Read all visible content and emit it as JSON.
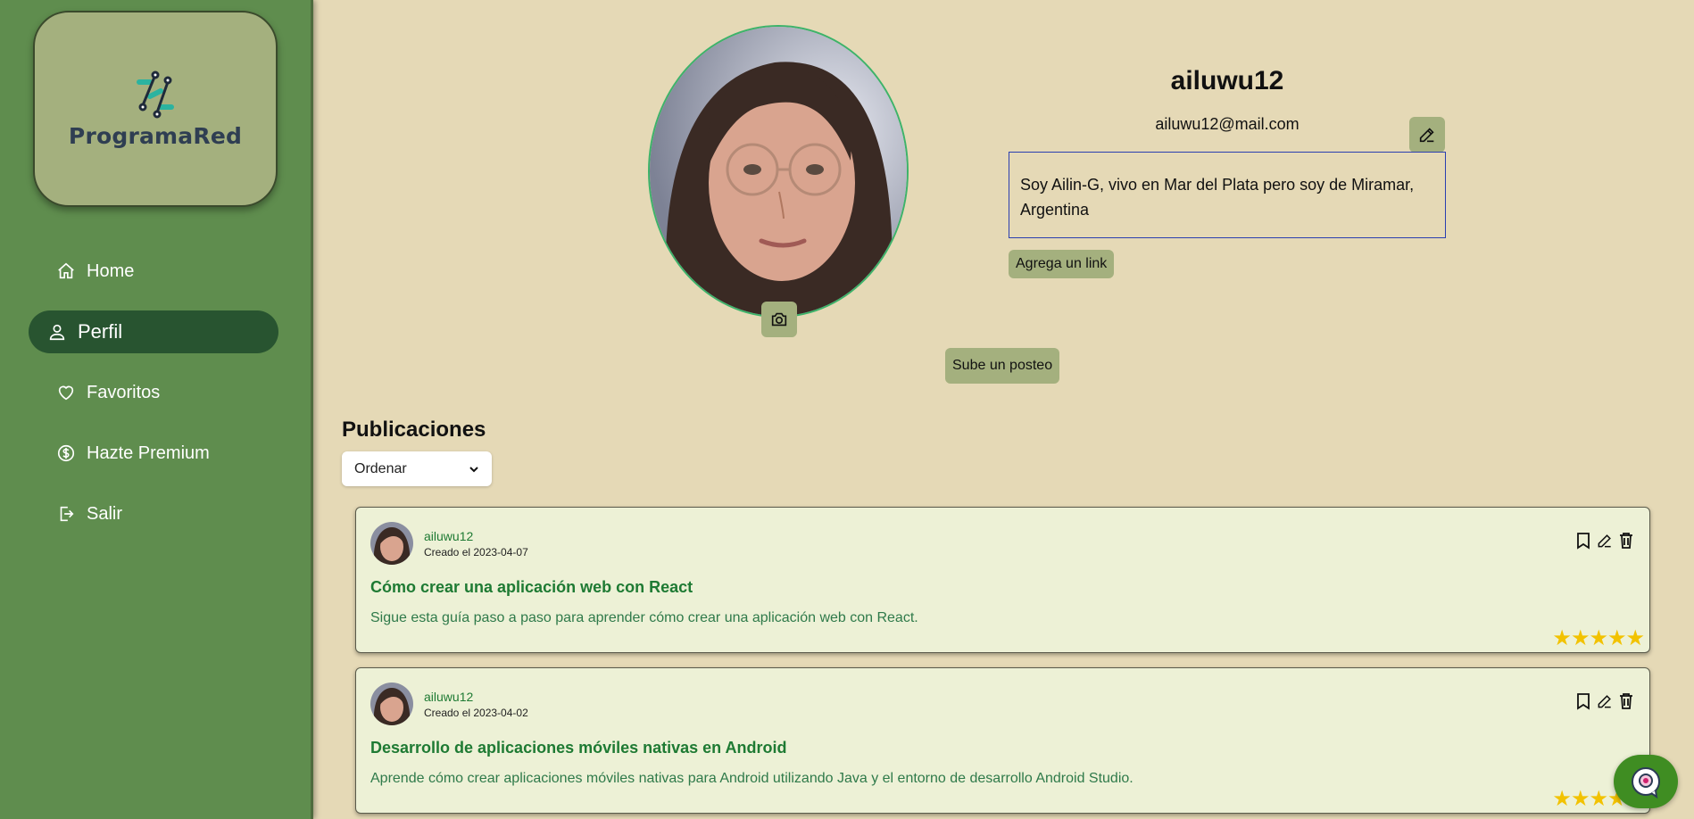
{
  "brand": {
    "name": "ProgramaRed",
    "logo_icon": "programared-logo"
  },
  "sidebar": {
    "items": [
      {
        "label": "Home",
        "icon": "home-icon"
      },
      {
        "label": "Perfil",
        "icon": "user-icon",
        "active": true
      },
      {
        "label": "Favoritos",
        "icon": "heart-icon"
      },
      {
        "label": "Hazte Premium",
        "icon": "dollar-circle-icon"
      },
      {
        "label": "Salir",
        "icon": "logout-icon"
      }
    ]
  },
  "profile": {
    "username": "ailuwu12",
    "email": "ailuwu12@mail.com",
    "bio": "Soy Ailin-G, vivo en Mar del Plata pero soy de Miramar, Argentina",
    "add_link_label": "Agrega un link",
    "upload_post_label": "Sube un posteo"
  },
  "publications": {
    "title": "Publicaciones",
    "sort": {
      "selected": "Ordenar"
    },
    "posts": [
      {
        "user": "ailuwu12",
        "date": "Creado el 2023-04-07",
        "title": "Cómo crear una aplicación web con React",
        "description": "Sigue esta guía paso a paso para aprender cómo crear una aplicación web con React.",
        "rating": 5
      },
      {
        "user": "ailuwu12",
        "date": "Creado el 2023-04-02",
        "title": "Desarrollo de aplicaciones móviles nativas en Android",
        "description": "Aprende cómo crear aplicaciones móviles nativas para Android utilizando Java y el entorno de desarrollo Android Studio.",
        "rating": 5
      }
    ]
  },
  "colors": {
    "background": "#e5d9b6",
    "sidebar": "#5f8d4e",
    "active_nav": "#285430",
    "button": "#a4b07e",
    "card": "#edf1d6",
    "accent_text": "#1e7a33",
    "star": "#f2c200"
  }
}
